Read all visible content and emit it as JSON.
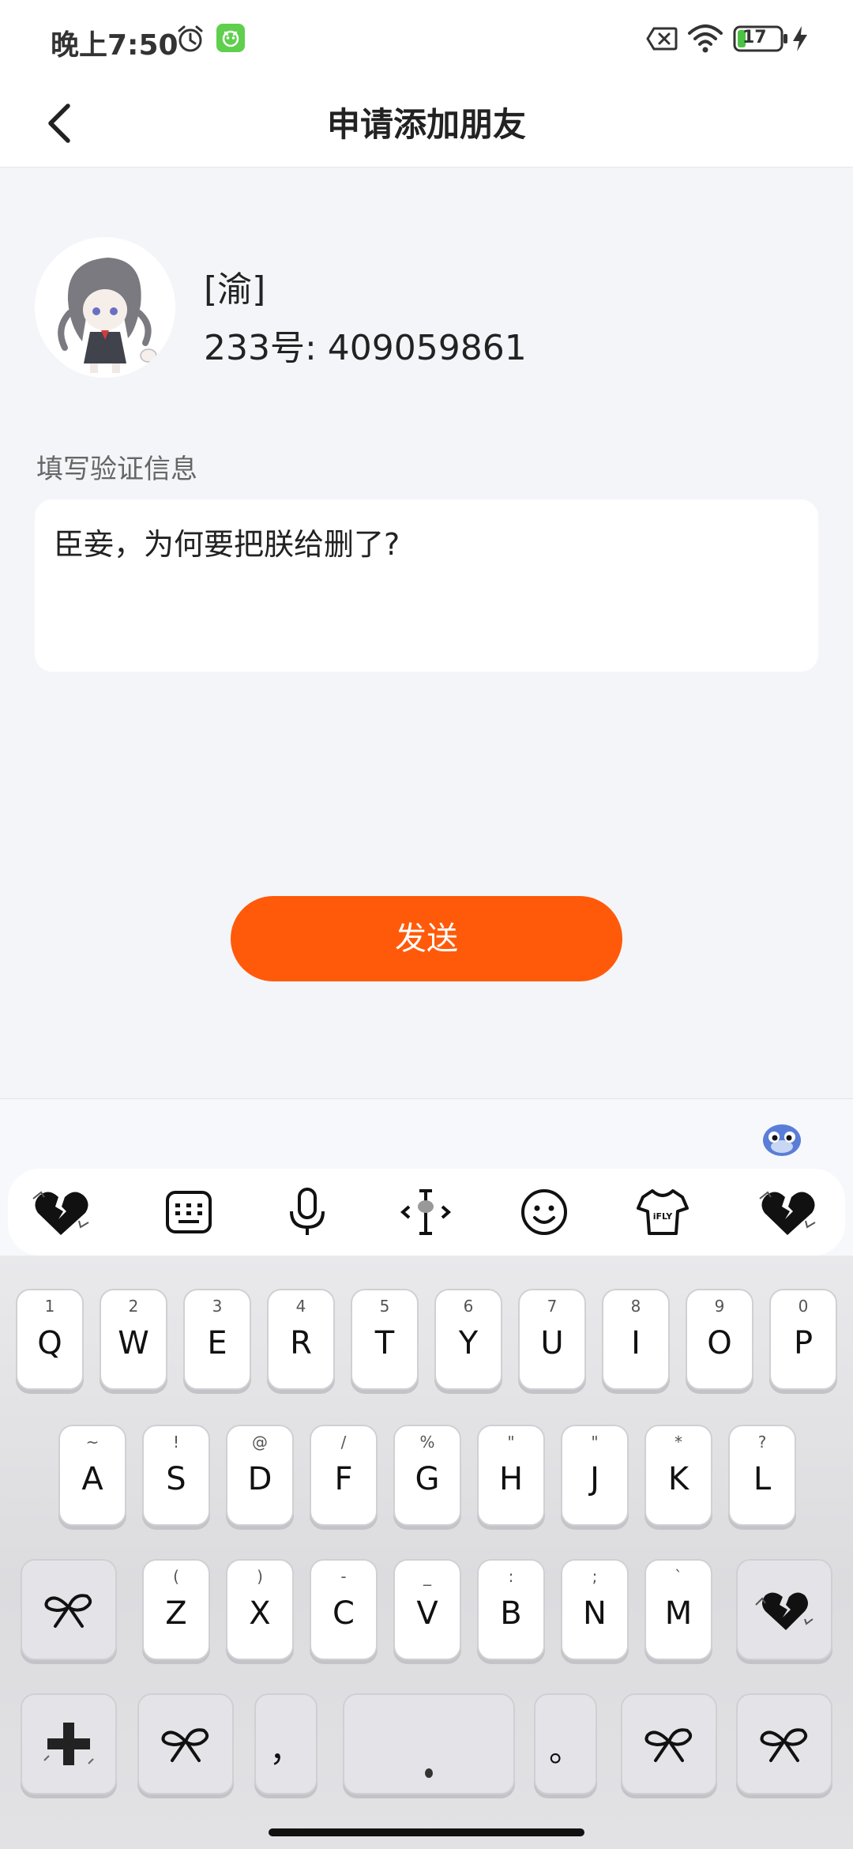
{
  "status_bar": {
    "time": "晚上7:50",
    "battery": "17"
  },
  "header": {
    "title": "申请添加朋友"
  },
  "profile": {
    "name": "[渝]",
    "id": "233号: 409059861"
  },
  "verify": {
    "label": "填写验证信息",
    "value": "臣妾，为何要把朕给删了?"
  },
  "send_button": "发送",
  "keyboard": {
    "row1": [
      {
        "sub": "1",
        "main": "Q"
      },
      {
        "sub": "2",
        "main": "W"
      },
      {
        "sub": "3",
        "main": "E"
      },
      {
        "sub": "4",
        "main": "R"
      },
      {
        "sub": "5",
        "main": "T"
      },
      {
        "sub": "6",
        "main": "Y"
      },
      {
        "sub": "7",
        "main": "U"
      },
      {
        "sub": "8",
        "main": "I"
      },
      {
        "sub": "9",
        "main": "O"
      },
      {
        "sub": "0",
        "main": "P"
      }
    ],
    "row2": [
      {
        "sub": "~",
        "main": "A"
      },
      {
        "sub": "!",
        "main": "S"
      },
      {
        "sub": "@",
        "main": "D"
      },
      {
        "sub": "/",
        "main": "F"
      },
      {
        "sub": "%",
        "main": "G"
      },
      {
        "sub": "\"",
        "main": "H"
      },
      {
        "sub": "\"",
        "main": "J"
      },
      {
        "sub": "*",
        "main": "K"
      },
      {
        "sub": "?",
        "main": "L"
      }
    ],
    "row3": [
      {
        "sub": "(",
        "main": "Z"
      },
      {
        "sub": ")",
        "main": "X"
      },
      {
        "sub": "-",
        "main": "C"
      },
      {
        "sub": "_",
        "main": "V"
      },
      {
        "sub": ":",
        "main": "B"
      },
      {
        "sub": ";",
        "main": "N"
      },
      {
        "sub": "`",
        "main": "M"
      }
    ],
    "comma": "，",
    "period": "。"
  }
}
